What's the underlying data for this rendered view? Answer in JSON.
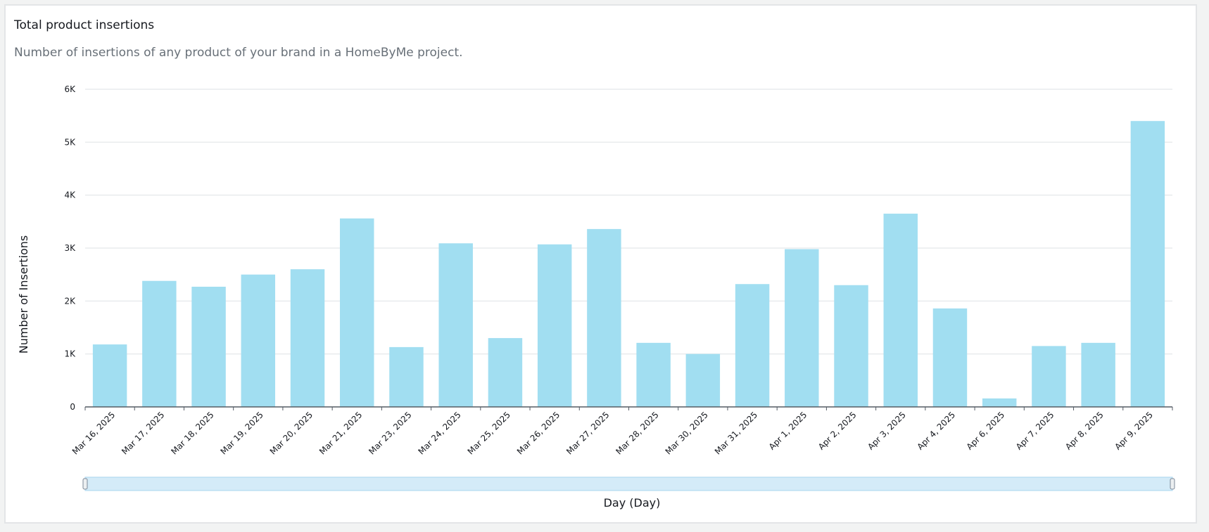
{
  "panel": {
    "title": "Total product insertions",
    "subtitle": "Number of insertions of any product of your brand in a HomeByMe project."
  },
  "colors": {
    "bar": "#a1def1",
    "grid": "#e9ebed",
    "axis": "#545b64",
    "scrollbar_fill": "#d4ebf8",
    "scrollbar_border": "#a9d4ee"
  },
  "chart_data": {
    "type": "bar",
    "title": "Total product insertions",
    "xlabel": "Day (Day)",
    "ylabel": "Number of Insertions",
    "ylim": [
      0,
      6000
    ],
    "yticks": [
      {
        "value": 0,
        "label": "0"
      },
      {
        "value": 1000,
        "label": "1K"
      },
      {
        "value": 2000,
        "label": "2K"
      },
      {
        "value": 3000,
        "label": "3K"
      },
      {
        "value": 4000,
        "label": "4K"
      },
      {
        "value": 5000,
        "label": "5K"
      },
      {
        "value": 6000,
        "label": "6K"
      }
    ],
    "grid": true,
    "categories": [
      "Mar 16, 2025",
      "Mar 17, 2025",
      "Mar 18, 2025",
      "Mar 19, 2025",
      "Mar 20, 2025",
      "Mar 21, 2025",
      "Mar 23, 2025",
      "Mar 24, 2025",
      "Mar 25, 2025",
      "Mar 26, 2025",
      "Mar 27, 2025",
      "Mar 28, 2025",
      "Mar 30, 2025",
      "Mar 31, 2025",
      "Apr 1, 2025",
      "Apr 2, 2025",
      "Apr 3, 2025",
      "Apr 4, 2025",
      "Apr 6, 2025",
      "Apr 7, 2025",
      "Apr 8, 2025",
      "Apr 9, 2025"
    ],
    "values": [
      1180,
      2380,
      2270,
      2500,
      2600,
      3560,
      1130,
      3090,
      1300,
      3070,
      3360,
      1210,
      1000,
      2320,
      2980,
      2300,
      3650,
      1860,
      160,
      1150,
      1210,
      5400
    ]
  }
}
